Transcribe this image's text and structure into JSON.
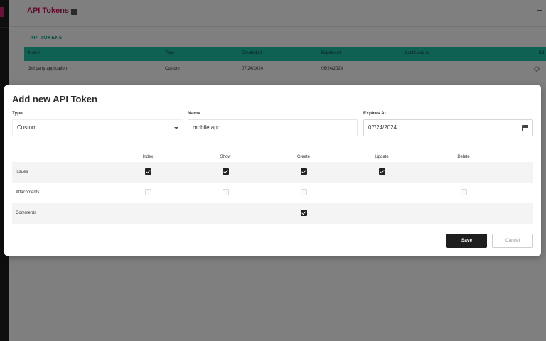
{
  "page": {
    "title": "API Tokens",
    "section_title": "API TOKENS",
    "table_headers": [
      "Name",
      "Type",
      "Created At",
      "Expires At",
      "Last Used At",
      "Ed"
    ],
    "rows": [
      {
        "name": "3rd party application",
        "type": "Custom",
        "created_at": "07/24/2024",
        "expires_at": "06/24/2024"
      }
    ]
  },
  "modal": {
    "title": "Add new API Token",
    "type_label": "Type",
    "type_value": "Custom",
    "name_label": "Name",
    "name_value": "mobile app",
    "expires_label": "Expires At",
    "expires_value": "07/24/2024",
    "permission_columns": [
      "Index",
      "Show",
      "Create",
      "Update",
      "Delete"
    ],
    "permissions": [
      {
        "label": "Issues",
        "values": [
          true,
          true,
          true,
          true,
          null
        ]
      },
      {
        "label": "Attachments",
        "values": [
          false,
          false,
          false,
          null,
          false
        ]
      },
      {
        "label": "Comments",
        "values": [
          null,
          null,
          true,
          null,
          null
        ]
      }
    ],
    "save_label": "Save",
    "cancel_label": "Cancel"
  },
  "colors": {
    "accent": "#1fc3a6",
    "brand": "#c2185b",
    "primary_button": "#1e1e1e"
  }
}
